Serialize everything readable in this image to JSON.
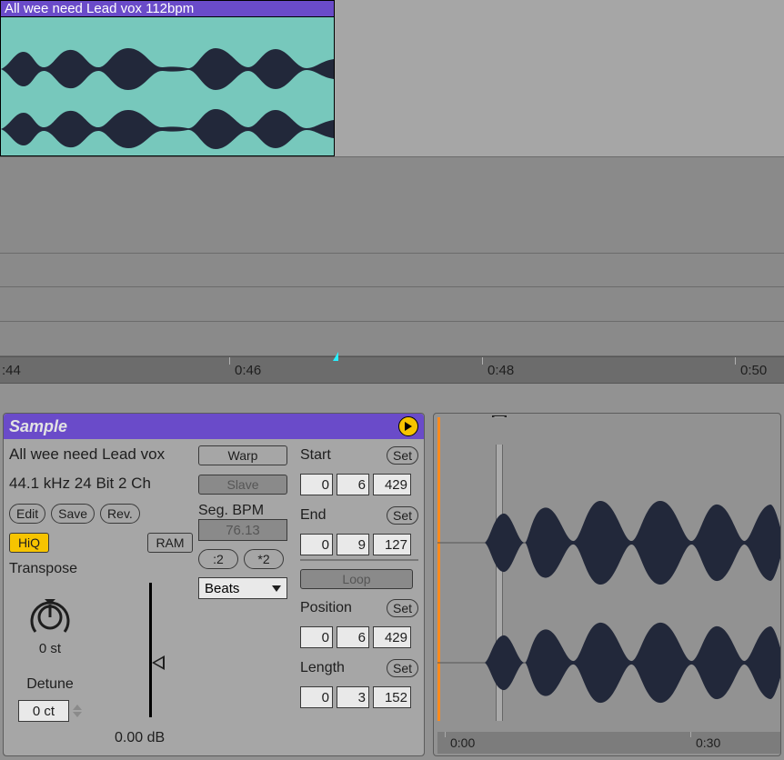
{
  "clip": {
    "title": "All wee need Lead vox 112bpm"
  },
  "ruler": {
    "edge_left": ":44",
    "t1": "0:46",
    "t2": "0:48",
    "t3": "0:50"
  },
  "panel": {
    "title": "Sample"
  },
  "sample_info": {
    "name": "All wee need Lead vox",
    "props": "44.1 kHz 24 Bit 2 Ch"
  },
  "buttons": {
    "edit": "Edit",
    "save": "Save",
    "rev": "Rev.",
    "hiq": "HiQ",
    "ram": "RAM",
    "warp": "Warp",
    "slave": "Slave",
    "half": ":2",
    "double": "*2",
    "set1": "Set",
    "set2": "Set",
    "set3": "Set",
    "set4": "Set",
    "loop": "Loop"
  },
  "labels": {
    "transpose": "Transpose",
    "detune": "Detune",
    "segbpm": "Seg. BPM",
    "start": "Start",
    "end": "End",
    "position": "Position",
    "length": "Length"
  },
  "values": {
    "segbpm": "76.13",
    "warp_mode": "Beats",
    "transpose": "0 st",
    "detune": "0 ct",
    "gain": "0.00 dB",
    "start": [
      "0",
      "6",
      "429"
    ],
    "end": [
      "0",
      "9",
      "127"
    ],
    "position": [
      "0",
      "6",
      "429"
    ],
    "length": [
      "0",
      "3",
      "152"
    ]
  },
  "sample_ruler": {
    "t0": "0:00",
    "t1": "0:30"
  }
}
